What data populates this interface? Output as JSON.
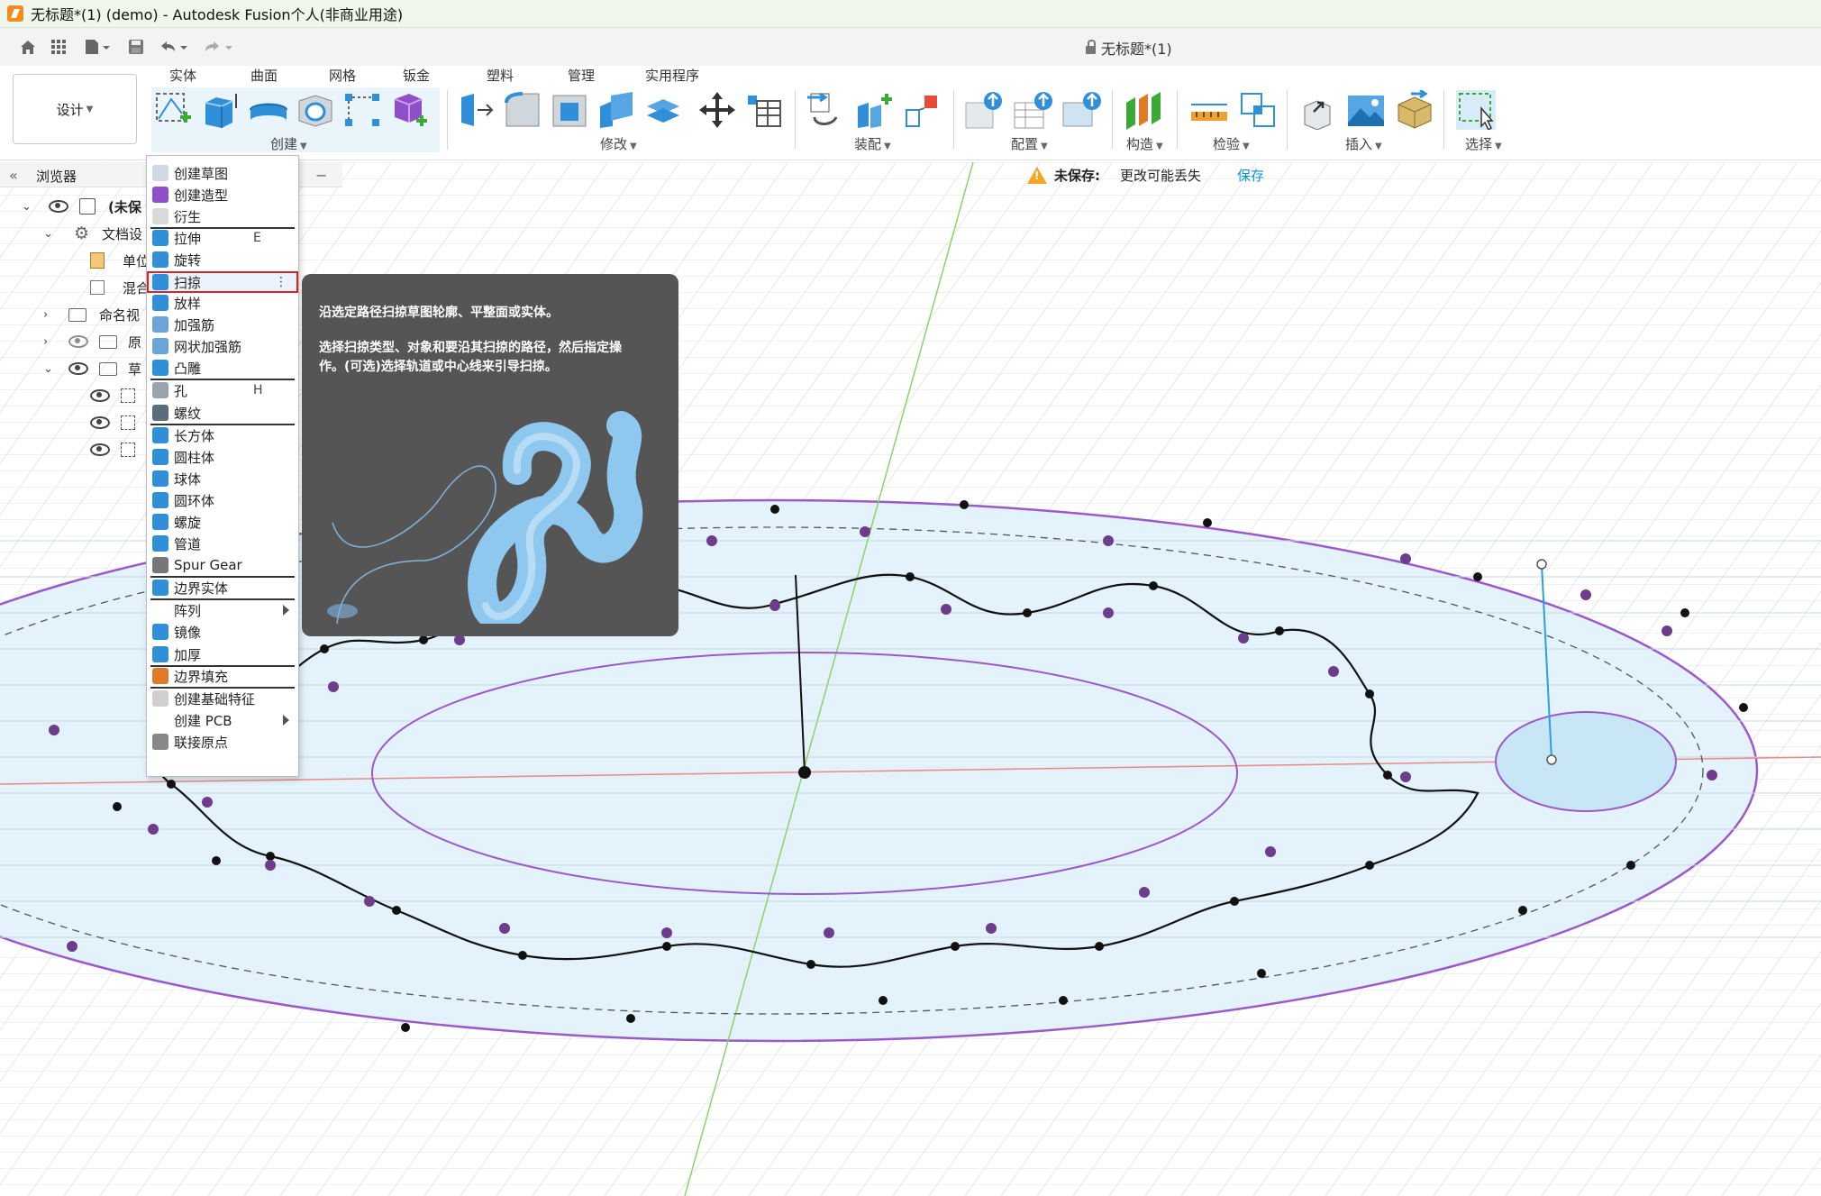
{
  "window": {
    "title": "无标题*(1) (demo) - Autodesk Fusion个人(非商业用途)"
  },
  "document": {
    "title": "无标题*(1)"
  },
  "workspace": {
    "label": "设计"
  },
  "tabs": [
    "实体",
    "曲面",
    "网格",
    "钣金",
    "塑料",
    "管理",
    "实用程序"
  ],
  "ribbon_groups": {
    "create": "创建",
    "modify": "修改",
    "assemble": "装配",
    "configure": "配置",
    "construct": "构造",
    "inspect": "检验",
    "insert": "插入",
    "select": "选择"
  },
  "browser": {
    "title": "浏览器",
    "items": [
      "(未保",
      "文档设",
      "单位",
      "混合",
      "命名视",
      "原",
      "草"
    ]
  },
  "notice": {
    "label": "未保存:",
    "message": "更改可能丢失",
    "save": "保存"
  },
  "create_menu": {
    "items": [
      {
        "label": "创建草图",
        "icon": "sketch-icon",
        "color": "#cfd8e3"
      },
      {
        "label": "创建造型",
        "icon": "form-icon",
        "color": "#8e4fc9"
      },
      {
        "label": "衍生",
        "icon": "derive-icon",
        "color": "#d9d9d9"
      },
      {
        "label": "拉伸",
        "shortcut": "E",
        "icon": "extrude-icon",
        "color": "#2f8fd8"
      },
      {
        "label": "旋转",
        "icon": "revolve-icon",
        "color": "#2f8fd8"
      },
      {
        "label": "扫掠",
        "icon": "sweep-icon",
        "color": "#2f8fd8"
      },
      {
        "label": "放样",
        "icon": "loft-icon",
        "color": "#2f8fd8"
      },
      {
        "label": "加强筋",
        "icon": "rib-icon",
        "color": "#6aa4d8"
      },
      {
        "label": "网状加强筋",
        "icon": "web-icon",
        "color": "#6aa4d8"
      },
      {
        "label": "凸雕",
        "icon": "emboss-icon",
        "color": "#2f8fd8"
      },
      {
        "label": "孔",
        "shortcut": "H",
        "icon": "hole-icon",
        "color": "#9aa3ad"
      },
      {
        "label": "螺纹",
        "icon": "thread-icon",
        "color": "#5b6c7d"
      },
      {
        "label": "长方体",
        "icon": "box-icon",
        "color": "#2f8fd8"
      },
      {
        "label": "圆柱体",
        "icon": "cylinder-icon",
        "color": "#2f8fd8"
      },
      {
        "label": "球体",
        "icon": "sphere-icon",
        "color": "#2f8fd8"
      },
      {
        "label": "圆环体",
        "icon": "torus-icon",
        "color": "#2f8fd8"
      },
      {
        "label": "螺旋",
        "icon": "coil-icon",
        "color": "#2f8fd8"
      },
      {
        "label": "管道",
        "icon": "pipe-icon",
        "color": "#2f8fd8"
      },
      {
        "label": "Spur Gear",
        "icon": "gear-icon",
        "color": "#777777"
      },
      {
        "label": "边界实体",
        "icon": "boundary-icon",
        "color": "#2f8fd8"
      },
      {
        "label": "阵列",
        "icon": "pattern-icon",
        "color": "#ffffff",
        "submenu": true
      },
      {
        "label": "镜像",
        "icon": "mirror-icon",
        "color": "#2f8fd8"
      },
      {
        "label": "加厚",
        "icon": "thicken-icon",
        "color": "#2f8fd8"
      },
      {
        "label": "边界填充",
        "icon": "boundary-fill-icon",
        "color": "#e07b2a"
      },
      {
        "label": "创建基础特征",
        "icon": "base-feature-icon",
        "color": "#cfcfcf"
      },
      {
        "label": "创建 PCB",
        "icon": "pcb-icon",
        "color": "#ffffff",
        "submenu": true
      },
      {
        "label": "联接原点",
        "icon": "joint-origin-icon",
        "color": "#888888"
      }
    ]
  },
  "tooltip": {
    "line1": "沿选定路径扫掠草图轮廓、平整面或实体。",
    "line2": "选择扫掠类型、对象和要沿其扫掠的路径，然后指定操",
    "line3": "作。(可选)选择轨道或中心线来引导扫掠。"
  },
  "colors": {
    "accent": "#0696d7",
    "highlight": "#d8232a",
    "sketch_fill": "#e3f2fb",
    "profile_line": "#9b59c9"
  }
}
